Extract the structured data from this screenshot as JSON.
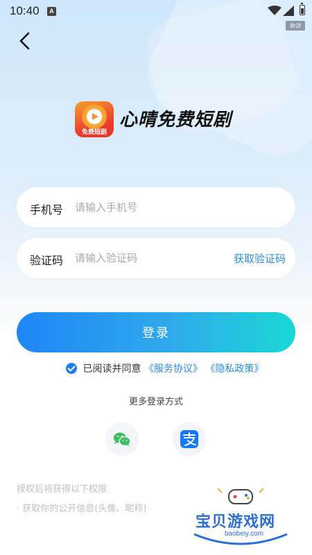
{
  "status_bar": {
    "time": "10:40",
    "notification_badge": "A",
    "debug_tag": "8r3f"
  },
  "app": {
    "title": "心晴免费短剧",
    "logo_caption": "免费短剧"
  },
  "form": {
    "phone_label": "手机号",
    "phone_placeholder": "请输入手机号",
    "phone_value": "",
    "code_label": "验证码",
    "code_placeholder": "请输入验证码",
    "code_value": "",
    "get_code_label": "获取验证码"
  },
  "login_button_label": "登录",
  "agreement": {
    "checked": true,
    "prefix": "已阅读并同意",
    "service_link": "《服务协议》",
    "privacy_link": "《隐私政策》"
  },
  "more_login_label": "更多登录方式",
  "social_logins": [
    {
      "name": "wechat-icon",
      "color": "#3dc05f"
    },
    {
      "name": "alipay-icon",
      "color": "#1677ff"
    }
  ],
  "permissions": {
    "title": "授权后将获得以下权限",
    "item": "· 获取你的公开信息(头像、昵称)"
  },
  "watermark": {
    "text": "宝贝游戏网",
    "url": "baobeiy.com"
  },
  "colors": {
    "accent": "#2a8bea",
    "button_start": "#1f86f7",
    "button_end": "#19d8d4"
  }
}
